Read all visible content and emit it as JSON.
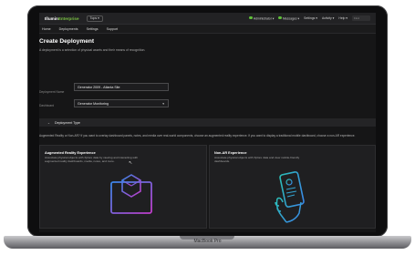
{
  "device": {
    "label": "MacBook Pro"
  },
  "topbar": {
    "logo_part1": "Illumin",
    "logo_part2": "Enterprise",
    "tenant": "Tops ▾",
    "items": [
      "Administrator ▾",
      "Messages ▾",
      "Settings ▾",
      "Activity ▾",
      "Help ▾"
    ],
    "search_placeholder": "Find"
  },
  "subnav": {
    "items": [
      "Home",
      "Deployments",
      "Settings",
      "Support"
    ]
  },
  "page": {
    "title": "Create Deployment",
    "description": "A deployment is a selection of physical assets and their means of recognition."
  },
  "form": {
    "name_label": "Deployment Name",
    "name_value": "Generator 2009 - Atlanta Site",
    "dashboard_label": "Dashboard",
    "dashboard_value": "Generator Monitoring"
  },
  "deployment_type": {
    "section_title": "Deployment Type",
    "description": "Augmented Reality or Non-AR? If you want to overlay dashboard panels, notes, and media over real-world components, choose an augmented reality experience. If you want to display a traditional mobile dashboard, choose a non-AR experience.",
    "cards": [
      {
        "title": "Augmented Reality Experience",
        "description": "Associate physical objects with Xplore data by viewing and interacting with augmented reality dashboards, media, notes, and more."
      },
      {
        "title": "Non-AR Experience",
        "description": "Associate physical objects with Xplore data and view mobile-friendly dashboards."
      }
    ]
  },
  "colors": {
    "accent_green": "#7ac043",
    "ar_icon_blue": "#3a86e8",
    "ar_icon_magenta": "#c13ccb",
    "nonar_icon_teal": "#2bc0b8"
  },
  "icons": [
    "chevron-down-icon",
    "ar-cube-icon",
    "phone-hand-icon",
    "cursor-icon"
  ]
}
